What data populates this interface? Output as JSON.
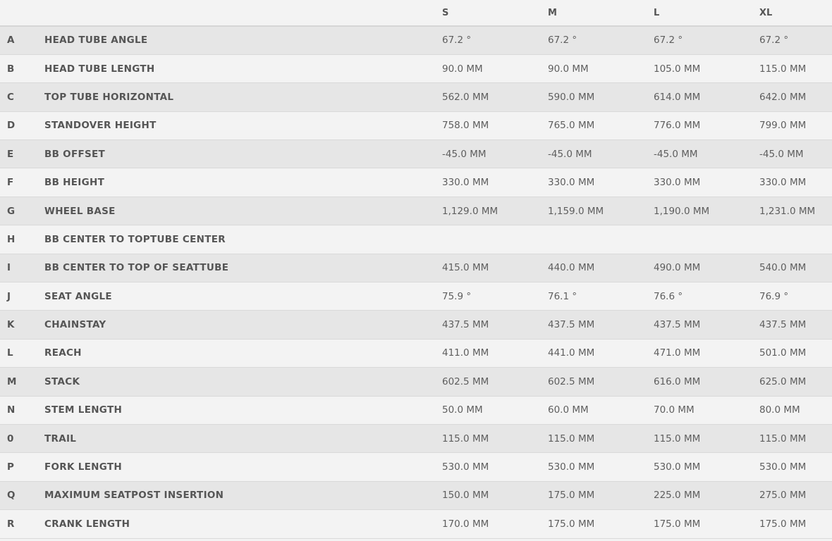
{
  "sizes": [
    "S",
    "M",
    "L",
    "XL"
  ],
  "rows": [
    {
      "id": "A",
      "label": "HEAD TUBE ANGLE",
      "values": [
        "67.2 °",
        "67.2 °",
        "67.2 °",
        "67.2 °"
      ]
    },
    {
      "id": "B",
      "label": "HEAD TUBE LENGTH",
      "values": [
        "90.0 MM",
        "90.0 MM",
        "105.0 MM",
        "115.0 MM"
      ]
    },
    {
      "id": "C",
      "label": "TOP TUBE HORIZONTAL",
      "values": [
        "562.0 MM",
        "590.0 MM",
        "614.0 MM",
        "642.0 MM"
      ]
    },
    {
      "id": "D",
      "label": "STANDOVER HEIGHT",
      "values": [
        "758.0 MM",
        "765.0 MM",
        "776.0 MM",
        "799.0 MM"
      ]
    },
    {
      "id": "E",
      "label": "BB OFFSET",
      "values": [
        "-45.0 MM",
        "-45.0 MM",
        "-45.0 MM",
        "-45.0 MM"
      ]
    },
    {
      "id": "F",
      "label": "BB HEIGHT",
      "values": [
        "330.0 MM",
        "330.0 MM",
        "330.0 MM",
        "330.0 MM"
      ]
    },
    {
      "id": "G",
      "label": "WHEEL BASE",
      "values": [
        "1,129.0 MM",
        "1,159.0 MM",
        "1,190.0 MM",
        "1,231.0 MM"
      ]
    },
    {
      "id": "H",
      "label": "BB CENTER TO TOPTUBE CENTER",
      "values": [
        "",
        "",
        "",
        ""
      ]
    },
    {
      "id": "I",
      "label": "BB CENTER TO TOP OF SEATTUBE",
      "values": [
        "415.0 MM",
        "440.0 MM",
        "490.0 MM",
        "540.0 MM"
      ]
    },
    {
      "id": "J",
      "label": "SEAT ANGLE",
      "values": [
        "75.9 °",
        "76.1 °",
        "76.6 °",
        "76.9 °"
      ]
    },
    {
      "id": "K",
      "label": "CHAINSTAY",
      "values": [
        "437.5 MM",
        "437.5 MM",
        "437.5 MM",
        "437.5 MM"
      ]
    },
    {
      "id": "L",
      "label": "REACH",
      "values": [
        "411.0 MM",
        "441.0 MM",
        "471.0 MM",
        "501.0 MM"
      ]
    },
    {
      "id": "M",
      "label": "STACK",
      "values": [
        "602.5 MM",
        "602.5 MM",
        "616.0 MM",
        "625.0 MM"
      ]
    },
    {
      "id": "N",
      "label": "STEM LENGTH",
      "values": [
        "50.0 MM",
        "60.0 MM",
        "70.0 MM",
        "80.0 MM"
      ]
    },
    {
      "id": "0",
      "label": "TRAIL",
      "values": [
        "115.0 MM",
        "115.0 MM",
        "115.0 MM",
        "115.0 MM"
      ]
    },
    {
      "id": "P",
      "label": "FORK LENGTH",
      "values": [
        "530.0 MM",
        "530.0 MM",
        "530.0 MM",
        "530.0 MM"
      ]
    },
    {
      "id": "Q",
      "label": "MAXIMUM SEATPOST INSERTION",
      "values": [
        "150.0 MM",
        "175.0 MM",
        "225.0 MM",
        "275.0 MM"
      ]
    },
    {
      "id": "R",
      "label": "CRANK LENGTH",
      "values": [
        "170.0 MM",
        "175.0 MM",
        "175.0 MM",
        "175.0 MM"
      ]
    }
  ]
}
